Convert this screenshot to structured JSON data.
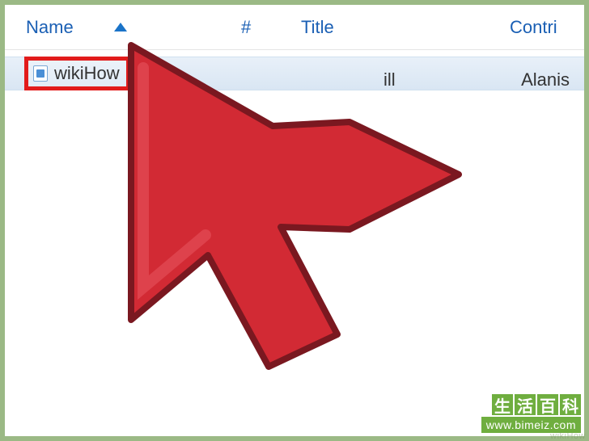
{
  "columns": {
    "name": "Name",
    "hash": "#",
    "title": "Title",
    "contrib": "Contri"
  },
  "row": {
    "filename": "wikiHow",
    "title_fragment": "ill",
    "contributor": "Alanis"
  },
  "watermark": {
    "chars": [
      "生",
      "活",
      "百",
      "科"
    ],
    "url": "www.bimeiz.com",
    "corner": "wikiHow"
  }
}
